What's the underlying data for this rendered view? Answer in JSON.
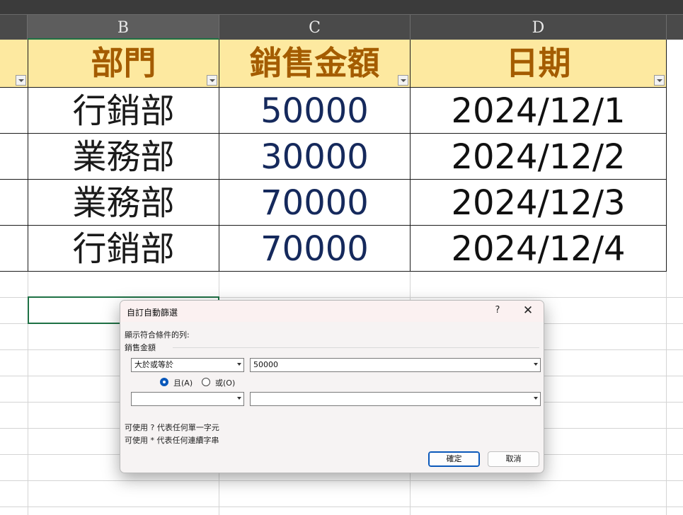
{
  "columns": [
    "B",
    "C",
    "D"
  ],
  "headers": {
    "b": "部門",
    "c": "銷售金額",
    "d": "日期"
  },
  "rows": [
    {
      "dept": "行銷部",
      "amount": "50000",
      "date": "2024/12/1"
    },
    {
      "dept": "業務部",
      "amount": "30000",
      "date": "2024/12/2"
    },
    {
      "dept": "業務部",
      "amount": "70000",
      "date": "2024/12/3"
    },
    {
      "dept": "行銷部",
      "amount": "70000",
      "date": "2024/12/4"
    }
  ],
  "dialog": {
    "title": "自訂自動篩選",
    "help": "?",
    "close": "✕",
    "show_rows_label": "顯示符合條件的列:",
    "field_label": "銷售金額",
    "operator1": "大於或等於",
    "value1": "50000",
    "and_label": "且(A)",
    "or_label": "或(O)",
    "operator2": "",
    "value2": "",
    "hint1": "可使用 ? 代表任何單一字元",
    "hint2": "可使用 * 代表任何連續字串",
    "ok": "確定",
    "cancel": "取消"
  },
  "colors": {
    "header_fill": "#fde9a0",
    "header_text": "#a45c00",
    "amount_text": "#15295c",
    "accent": "#0a58ba"
  }
}
